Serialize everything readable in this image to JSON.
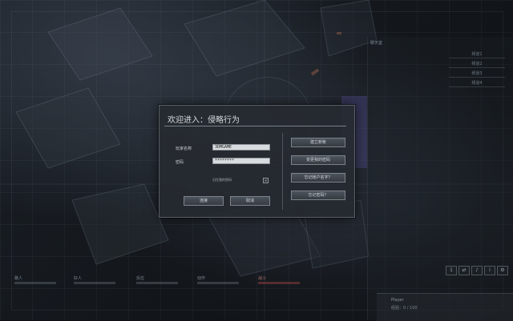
{
  "dialog": {
    "title": "欢迎进入：侵略行为",
    "username_label": "玩家名称",
    "username_value": "3DMGAME",
    "password_label": "密码",
    "password_value": "********",
    "remember_label": "记住我的密码",
    "checkbox_mark": "✕",
    "login_button": "连接",
    "cancel_button": "取消",
    "side_buttons": [
      "建立新帐",
      "变更我的密码",
      "忘记帐户名字？",
      "忘记密码？"
    ]
  },
  "bottom_tabs": [
    {
      "label": "路人",
      "active": false
    },
    {
      "label": "好人",
      "active": false
    },
    {
      "label": "反应",
      "active": false
    },
    {
      "label": "动作",
      "active": false
    },
    {
      "label": "战斗",
      "active": true
    }
  ],
  "player": {
    "name": "Player",
    "progress_text": "经验：0 / 100"
  },
  "bottom_icons": [
    "1",
    "⇄",
    "♪",
    "ⅰ",
    "⚙"
  ],
  "side_panel": {
    "title": "聊天室",
    "links": [
      "频道1",
      "频道2",
      "频道3",
      "频道4"
    ]
  },
  "colors": {
    "dialog_bg": "#262a30",
    "accent_active_tab": "#8c3c3c"
  }
}
